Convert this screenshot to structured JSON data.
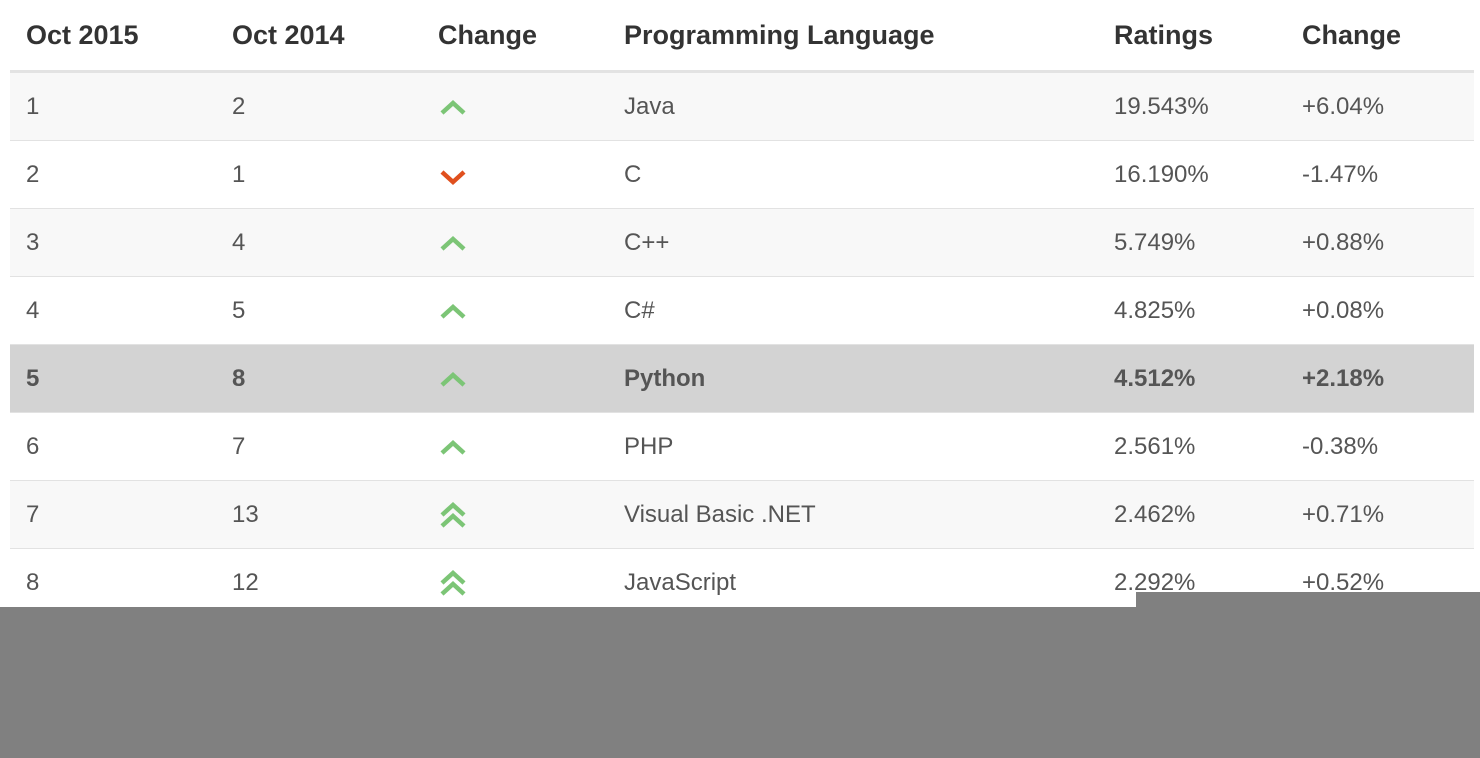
{
  "table": {
    "headers": [
      "Oct 2015",
      "Oct 2014",
      "Change",
      "Programming Language",
      "Ratings",
      "Change"
    ],
    "rows": [
      {
        "rank_2015": "1",
        "rank_2014": "2",
        "trend_icon": "chevron-up-icon",
        "language": "Java",
        "rating": "19.543%",
        "change": "+6.04%"
      },
      {
        "rank_2015": "2",
        "rank_2014": "1",
        "trend_icon": "chevron-down-icon",
        "language": "C",
        "rating": "16.190%",
        "change": "-1.47%"
      },
      {
        "rank_2015": "3",
        "rank_2014": "4",
        "trend_icon": "chevron-up-icon",
        "language": "C++",
        "rating": "5.749%",
        "change": "+0.88%"
      },
      {
        "rank_2015": "4",
        "rank_2014": "5",
        "trend_icon": "chevron-up-icon",
        "language": "C#",
        "rating": "4.825%",
        "change": "+0.08%"
      },
      {
        "rank_2015": "5",
        "rank_2014": "8",
        "trend_icon": "chevron-up-icon",
        "language": "Python",
        "rating": "4.512%",
        "change": "+2.18%"
      },
      {
        "rank_2015": "6",
        "rank_2014": "7",
        "trend_icon": "chevron-up-icon",
        "language": "PHP",
        "rating": "2.561%",
        "change": "-0.38%"
      },
      {
        "rank_2015": "7",
        "rank_2014": "13",
        "trend_icon": "double-chevron-up-icon",
        "language": "Visual Basic .NET",
        "rating": "2.462%",
        "change": "+0.71%"
      },
      {
        "rank_2015": "8",
        "rank_2014": "12",
        "trend_icon": "double-chevron-up-icon",
        "language": "JavaScript",
        "rating": "2.292%",
        "change": "+0.52%"
      }
    ],
    "highlighted_language": "Python"
  },
  "colors": {
    "up": "#7cc576",
    "down": "#e0501e",
    "highlight_row": "#d3d3d3"
  }
}
